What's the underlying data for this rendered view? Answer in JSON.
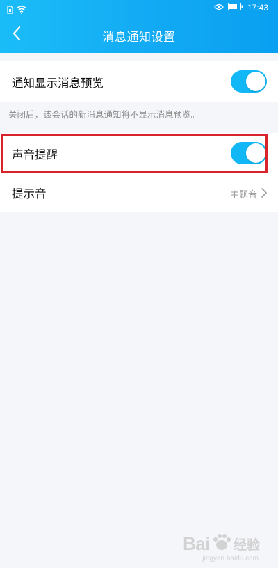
{
  "status_bar": {
    "time": "17:43",
    "battery_icon": "battery-icon",
    "eye_icon": "eye-icon",
    "sim_icon": "sim-card-icon",
    "wifi_icon": "wifi-icon"
  },
  "header": {
    "title": "消息通知设置",
    "back_icon": "chevron-left-icon",
    "gradient_colors": [
      "#1bbdf8",
      "#0aa0f1"
    ]
  },
  "settings": {
    "preview": {
      "label": "通知显示消息预览",
      "enabled": true,
      "hint": "关闭后，该会话的新消息通知将不显示消息预览。"
    },
    "sound": {
      "label": "声音提醒",
      "enabled": true,
      "highlighted": true
    },
    "tone": {
      "label": "提示音",
      "value": "主题音"
    }
  },
  "colors": {
    "toggle_on": "#12b7f5",
    "highlight_border": "#d9232a",
    "background": "#f5f6fa"
  },
  "watermark": {
    "brand": "Bai",
    "brand_suffix": "经验",
    "url": "jingyan.baidu.com"
  }
}
